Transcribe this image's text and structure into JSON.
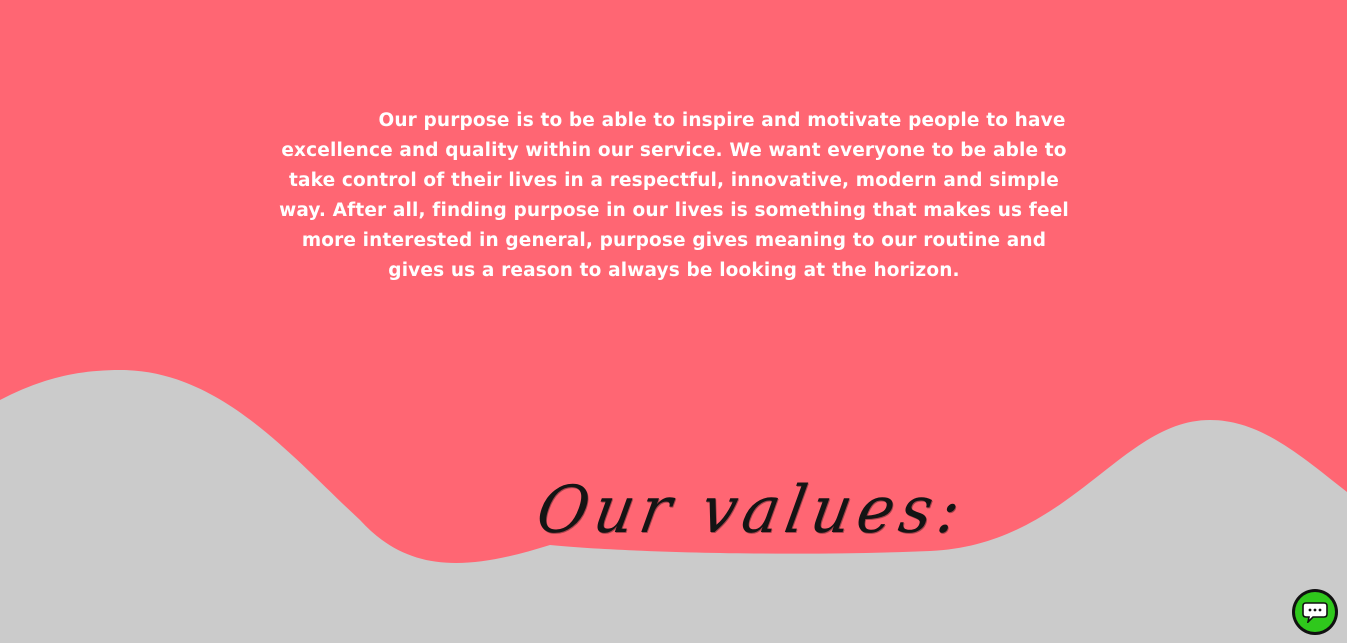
{
  "colors": {
    "coral": "#ff6673",
    "grey": "#cbcbcb",
    "chat_green": "#2fc81c",
    "chat_ring": "#111111"
  },
  "purpose": {
    "text": "Our purpose is to be able to inspire and motivate people to have excellence and quality within our service. We want everyone to be able to take control of their lives in a respectful, innovative, modern and simple way. After all, finding purpose in our lives is something that makes us feel more interested in general, purpose gives meaning to our routine and gives us a reason to always be looking at the horizon."
  },
  "values": {
    "heading": "Our values:"
  },
  "chat": {
    "icon": "chat-bubble-icon"
  }
}
